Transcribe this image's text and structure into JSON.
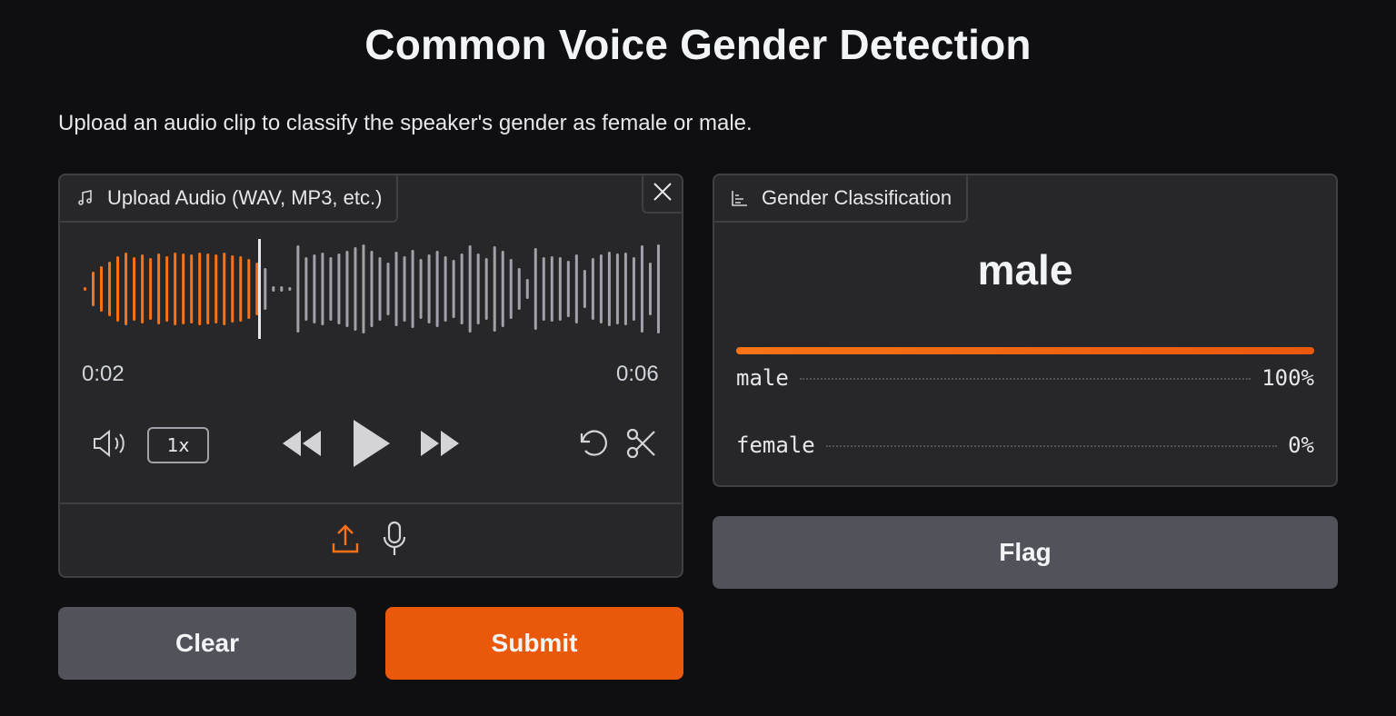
{
  "app": {
    "title": "Common Voice Gender Detection",
    "description": "Upload an audio clip to classify the speaker's gender as female or male."
  },
  "input": {
    "label": "Upload Audio (WAV, MP3, etc.)",
    "icon": "music-note-icon",
    "current_time": "0:02",
    "duration": "0:06",
    "playback_rate": "1x",
    "played_fraction": 0.3,
    "sources": [
      "upload-icon",
      "microphone-icon"
    ],
    "active_source": "upload"
  },
  "output": {
    "label": "Gender Classification",
    "icon": "bar-chart-icon",
    "prediction": "male",
    "confidences": [
      {
        "label": "male",
        "value": "100%",
        "fraction": 1.0
      },
      {
        "label": "female",
        "value": "0%",
        "fraction": 0.0
      }
    ]
  },
  "buttons": {
    "clear": "Clear",
    "submit": "Submit",
    "flag": "Flag"
  },
  "colors": {
    "accent": "#ea580c",
    "waveform_played": "#f97316",
    "waveform_unplayed": "#a1a1aa",
    "background": "#0f0f11",
    "panel": "#27272a"
  }
}
